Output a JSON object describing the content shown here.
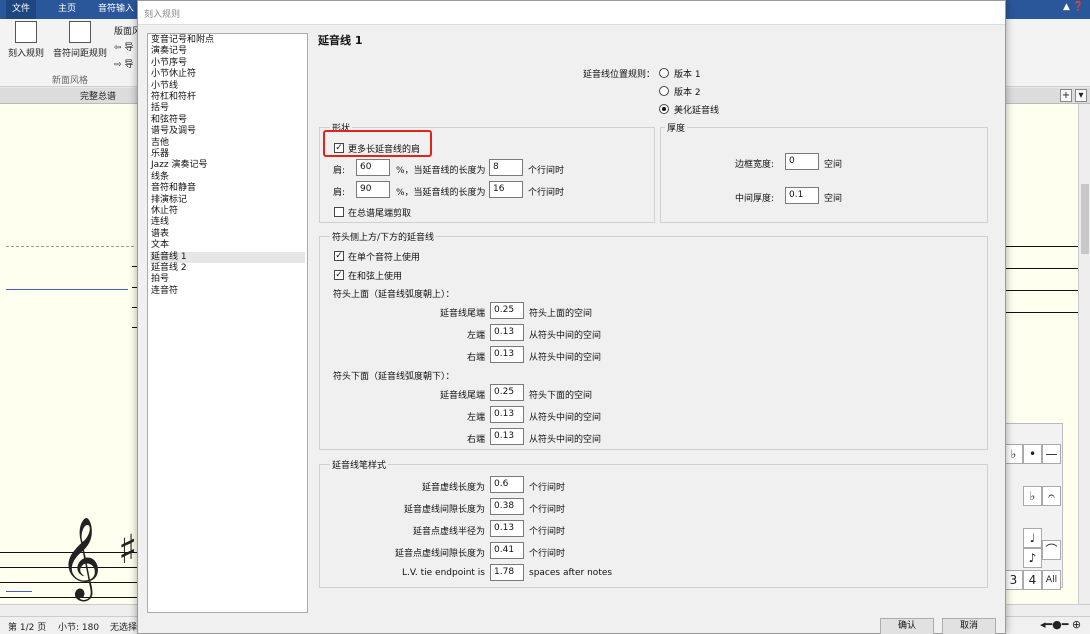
{
  "app": {
    "ribbon_tabs": [
      "文件",
      "主页",
      "音符输入"
    ],
    "ribbon_buttons": [
      "刻入规则",
      "音符间距规则"
    ],
    "ribbon_small": [
      "版面风",
      "导",
      "导"
    ],
    "ribbon_group": "新面风格",
    "doc_tab": "完整总谱",
    "status": {
      "page": "第 1/2 页",
      "bar": "小节: 180",
      "selection": "无选择"
    },
    "palette_cells": [
      "♭",
      "•",
      "—",
      "♭",
      "𝄐",
      "♩",
      "♪",
      "⌒",
      "3",
      "4",
      "All"
    ]
  },
  "dialog": {
    "title": "刻入规则",
    "categories": [
      "变音记号和附点",
      "演奏记号",
      "小节序号",
      "小节休止符",
      "小节线",
      "符杠和符杆",
      "括号",
      "和弦符号",
      "谱号及调号",
      "吉他",
      "乐器",
      "Jazz 演奏记号",
      "线条",
      "音符和静音",
      "排演标记",
      "休止符",
      "连线",
      "谱表",
      "文本",
      "延音线 1",
      "延音线 2",
      "拍号",
      "连音符"
    ],
    "selected_category": "延音线 1",
    "section_title": "延音线 1",
    "position_rule": {
      "label": "延音线位置规则：",
      "options": [
        "版本 1",
        "版本 2",
        "美化延音线"
      ],
      "selected": "美化延音线"
    },
    "shape": {
      "title": "形状",
      "longer_shoulder": "更多长延音线的肩",
      "shoulder_label": "肩:",
      "row1": {
        "pct": "60",
        "mid": "%，当延音线的长度为",
        "len": "8",
        "unit": "个行间时"
      },
      "row2": {
        "pct": "90",
        "mid": "%，当延音线的长度为",
        "len": "16",
        "unit": "个行间时"
      },
      "clip": "在总谱尾端剪取"
    },
    "thickness": {
      "title": "厚度",
      "edge_label": "边框宽度:",
      "edge_value": "0",
      "edge_unit": "空间",
      "mid_label": "中间厚度:",
      "mid_value": "0.1",
      "mid_unit": "空间"
    },
    "notehead": {
      "title": "符头侧上方/下方的延音线",
      "use_single": "在单个音符上使用",
      "use_chord": "在和弦上使用",
      "above_title": "符头上面（延音线弧度朝上）：",
      "below_title": "符头下面（延音线弧度朝下）：",
      "above": [
        {
          "label": "延音线尾端",
          "value": "0.25",
          "unit": "符头上面的空间"
        },
        {
          "label": "左端",
          "value": "0.13",
          "unit": "从符头中间的空间"
        },
        {
          "label": "右端",
          "value": "0.13",
          "unit": "从符头中间的空间"
        }
      ],
      "below": [
        {
          "label": "延音线尾端",
          "value": "0.25",
          "unit": "符头下面的空间"
        },
        {
          "label": "左端",
          "value": "0.13",
          "unit": "从符头中间的空间"
        },
        {
          "label": "右端",
          "value": "0.13",
          "unit": "从符头中间的空间"
        }
      ]
    },
    "pen": {
      "title": "延音线笔样式",
      "rows": [
        {
          "label": "延音虚线长度为",
          "value": "0.6",
          "unit": "个行间时"
        },
        {
          "label": "延音虚线间隙长度为",
          "value": "0.38",
          "unit": "个行间时"
        },
        {
          "label": "延音点虚线半径为",
          "value": "0.13",
          "unit": "个行间时"
        },
        {
          "label": "延音点虚线间隙长度为",
          "value": "0.41",
          "unit": "个行间时"
        },
        {
          "label": "L.V. tie endpoint is",
          "value": "1.78",
          "unit": "spaces after notes"
        }
      ]
    },
    "buttons": {
      "ok": "确认",
      "cancel": "取消"
    }
  },
  "colors": {
    "ribbon": "#2a579a",
    "highlight": "#e0231c",
    "arrow": "#4a5ad0"
  }
}
